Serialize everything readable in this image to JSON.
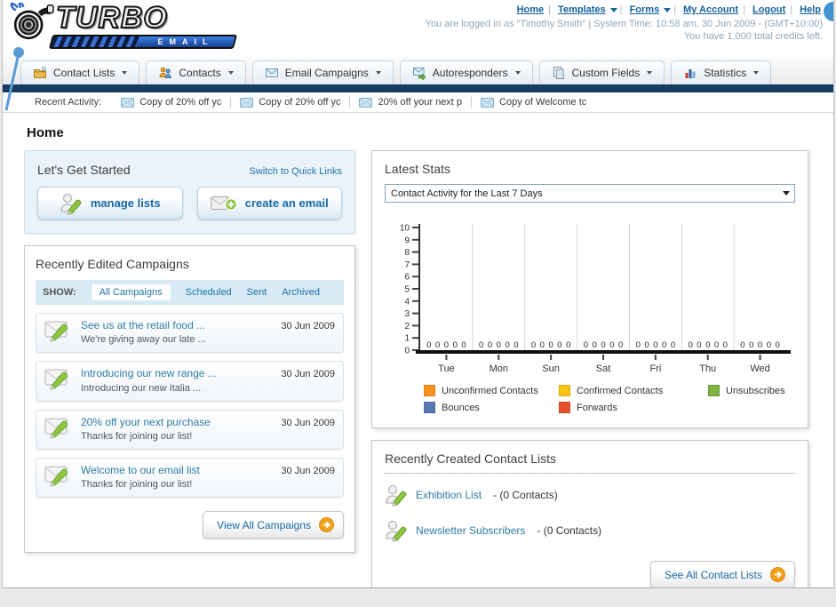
{
  "logo": {
    "brand": "TURBO",
    "sub": "EMAIL"
  },
  "topnav": {
    "links": [
      {
        "label": "Home"
      },
      {
        "label": "Templates"
      },
      {
        "label": "Forms"
      },
      {
        "label": "My Account"
      },
      {
        "label": "Logout"
      },
      {
        "label": "Help"
      }
    ],
    "login_info": "You are logged in as \"Timothy Smith\" | System Time: 10:58 am, 30 Jun 2009 - (GMT+10:00)",
    "credits": "You have 1,000 total credits left."
  },
  "tabs": [
    {
      "label": "Contact Lists"
    },
    {
      "label": "Contacts"
    },
    {
      "label": "Email Campaigns"
    },
    {
      "label": "Autoresponders"
    },
    {
      "label": "Custom Fields"
    },
    {
      "label": "Statistics"
    }
  ],
  "recent_activity": {
    "label": "Recent Activity:",
    "items": [
      "Copy of 20% off yc",
      "Copy of 20% off yc",
      "20% off your next p",
      "Copy of Welcome tc"
    ]
  },
  "page_title": "Home",
  "get_started": {
    "title": "Let's Get Started",
    "switch_link": "Switch to Quick Links",
    "manage_lists_label": "manage lists",
    "create_email_label": "create an email"
  },
  "campaigns": {
    "title": "Recently Edited Campaigns",
    "filter_label": "SHOW:",
    "filters": [
      "All Campaigns",
      "Scheduled",
      "Sent",
      "Archived"
    ],
    "active_filter": "All Campaigns",
    "items": [
      {
        "title": "See us at the retail food ...",
        "subtitle": "We're giving away our late ...",
        "date": "30 Jun 2009"
      },
      {
        "title": "Introducing our new range ...",
        "subtitle": "Introducing our new Italia ...",
        "date": "30 Jun 2009"
      },
      {
        "title": "20% off your next purchase",
        "subtitle": "Thanks for joining our list!",
        "date": "30 Jun 2009"
      },
      {
        "title": "Welcome to our email list",
        "subtitle": "Thanks for joining our list!",
        "date": "30 Jun 2009"
      }
    ],
    "view_all_label": "View All Campaigns"
  },
  "stats": {
    "title": "Latest Stats",
    "dropdown_value": "Contact Activity for the Last 7 Days"
  },
  "contact_lists": {
    "title": "Recently Created Contact Lists",
    "items": [
      {
        "name": "Exhibition List",
        "count": "- (0 Contacts)"
      },
      {
        "name": "Newsletter Subscribers",
        "count": "- (0 Contacts)"
      }
    ],
    "see_all_label": "See All Contact Lists"
  },
  "chart_data": {
    "type": "bar",
    "title": "Contact Activity for the Last 7 Days",
    "categories": [
      "Tue",
      "Mon",
      "Sun",
      "Sat",
      "Fri",
      "Thu",
      "Wed"
    ],
    "series": [
      {
        "name": "Unconfirmed Contacts",
        "color": "#f6921e",
        "values": [
          0,
          0,
          0,
          0,
          0,
          0,
          0
        ]
      },
      {
        "name": "Confirmed Contacts",
        "color": "#fdc512",
        "values": [
          0,
          0,
          0,
          0,
          0,
          0,
          0
        ]
      },
      {
        "name": "Unsubscribes",
        "color": "#7cb342",
        "values": [
          0,
          0,
          0,
          0,
          0,
          0,
          0
        ]
      },
      {
        "name": "Bounces",
        "color": "#5878b4",
        "values": [
          0,
          0,
          0,
          0,
          0,
          0,
          0
        ]
      },
      {
        "name": "Forwards",
        "color": "#e9502e",
        "values": [
          0,
          0,
          0,
          0,
          0,
          0,
          0
        ]
      }
    ],
    "xlabel": "",
    "ylabel": "",
    "ylim": [
      0,
      10
    ],
    "yticks": [
      0,
      1,
      2,
      3,
      4,
      5,
      6,
      7,
      8,
      9,
      10
    ],
    "grid": "vertical group separators",
    "legend_position": "bottom",
    "bar_value_labels": "shown (all 0)"
  }
}
